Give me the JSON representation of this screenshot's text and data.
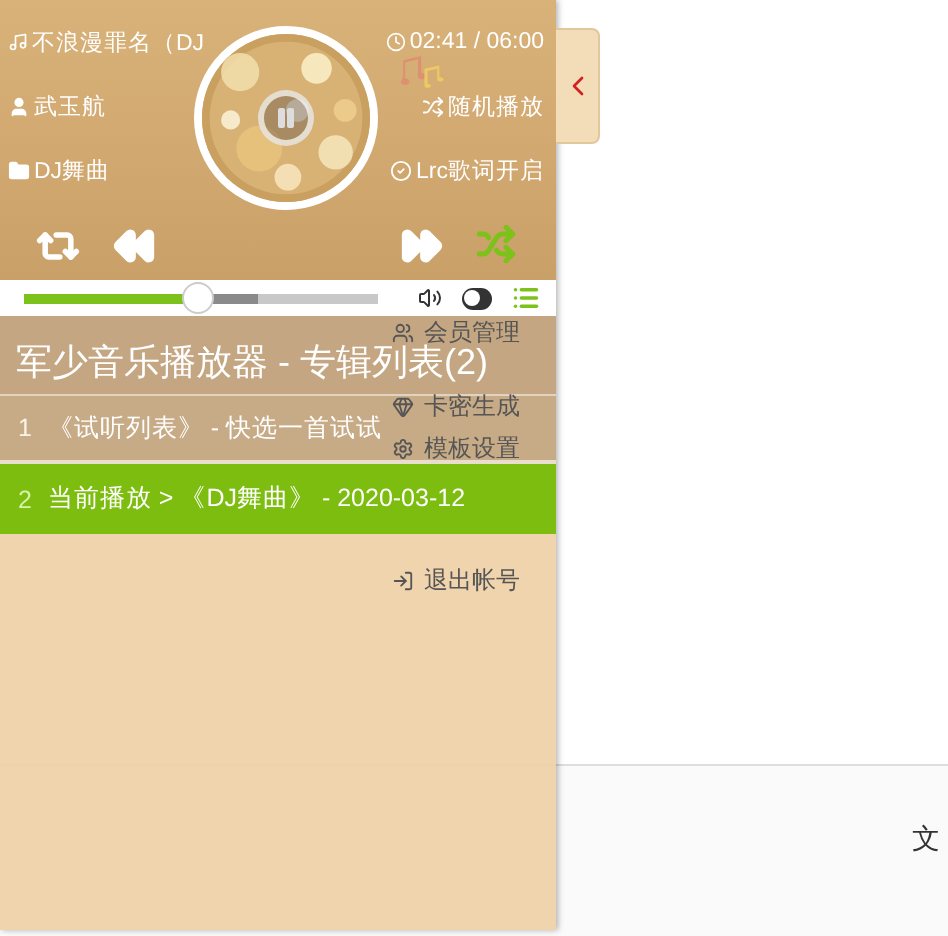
{
  "page": {
    "menu": [
      {
        "label": "会员管理"
      },
      {
        "label": "卡密生成"
      },
      {
        "label": "模板设置"
      },
      {
        "label": "退出帐号"
      }
    ],
    "footer_text": "文"
  },
  "player": {
    "song": "不浪漫罪名（DJ",
    "time_current": "02:41",
    "time_total": "/ 06:00",
    "artist": "武玉航",
    "mode": "随机播放",
    "album": "DJ舞曲",
    "lyrics": "Lrc歌词开启",
    "playing": true,
    "shuffle_on": true,
    "toggle_on": false,
    "progress": {
      "level": 0.49
    },
    "buffer": {
      "level": 0.66
    }
  },
  "playlist": {
    "title": "军少音乐播放器 - 专辑列表(2)",
    "items": [
      {
        "index": "1",
        "title": "《试听列表》 - 快选一首试试",
        "selected": false
      },
      {
        "index": "2",
        "title": "当前播放 > 《DJ舞曲》 - 2020-03-12",
        "selected": true
      }
    ]
  }
}
